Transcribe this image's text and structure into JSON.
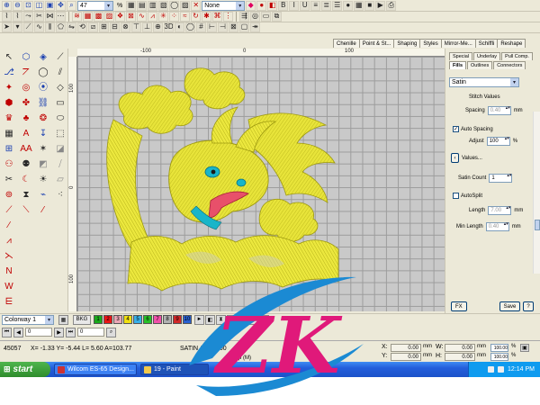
{
  "toolbar": {
    "zoom_value": "47",
    "zoom_unit": "%",
    "stitch_mode": "None",
    "design_zoom_value": "1",
    "design_zoom_unit": "%"
  },
  "object_tabs": [
    "Chenille",
    "Point & St...",
    "Shaping",
    "Styles",
    "Mirror-Me...",
    "Schiffli",
    "Reshape"
  ],
  "ruler": {
    "h_labels": [
      "-100",
      "0",
      "100"
    ],
    "v_labels": [
      "100",
      "0",
      "100"
    ]
  },
  "panel": {
    "tabs_row1": [
      "Special",
      "Underlay",
      "Pull Comp."
    ],
    "tabs_row2": [
      "Fills",
      "Outlines",
      "Connectors"
    ],
    "active_tab": "Fills",
    "fill_type": "Satin",
    "stitch_values_label": "Stitch Values",
    "spacing_label": "Spacing",
    "spacing_value": "0.40",
    "spacing_unit": "mm",
    "auto_spacing_label": "Auto Spacing",
    "auto_spacing_checked": true,
    "adjust_label": "Adjust",
    "adjust_value": "100",
    "adjust_unit": "%",
    "values_button": "Values...",
    "satin_count_label": "Satin Count",
    "satin_count_value": "1",
    "autosplit_label": "AutoSplit",
    "autosplit_checked": false,
    "length_label": "Length",
    "length_value": "7.00",
    "length_unit": "mm",
    "min_length_label": "Min Length",
    "min_length_value": "0.40",
    "min_length_unit": "mm",
    "fx_button": "FX",
    "save_button": "Save",
    "help_button": "?"
  },
  "colorway": {
    "label": "Colorway 1",
    "bkg_label": "BKG",
    "chips": [
      {
        "n": "1",
        "color": "#1aa81a"
      },
      {
        "n": "2",
        "color": "#e81414"
      },
      {
        "n": "3",
        "color": "#e8a6b4"
      },
      {
        "n": "4",
        "color": "#f0e010"
      },
      {
        "n": "5",
        "color": "#38b0e8"
      },
      {
        "n": "6",
        "color": "#28c028"
      },
      {
        "n": "7",
        "color": "#f050a8"
      },
      {
        "n": "8",
        "color": "#b0b0b0"
      },
      {
        "n": "9",
        "color": "#d02828"
      },
      {
        "n": "10",
        "color": "#2860d0"
      }
    ]
  },
  "minibar": {
    "field1": "0",
    "field2": "0"
  },
  "status": {
    "stitch_count": "45057",
    "coords": "X= -1.33 Y= -5.44 L= 5.60 A=103.77",
    "stitch_info": "SATIN Auto 1.00",
    "machine": "mp (M)",
    "x_label": "X:",
    "x_value": "0.00",
    "x_unit": "mm",
    "y_label": "Y:",
    "y_value": "0.00",
    "y_unit": "mm",
    "w_label": "W:",
    "w_value": "0.00",
    "w_unit": "mm",
    "h_label": "H:",
    "h_value": "0.00",
    "h_unit": "mm",
    "w_pct": "100.00",
    "h_pct": "100.00",
    "pct_unit": "%"
  },
  "taskbar": {
    "start_label": "start",
    "tasks": [
      "Wilcom ES-65 Design...",
      "19 - Paint"
    ],
    "clock": "12:14 PM"
  },
  "logo": {
    "text": "ZK",
    "colors": {
      "pink": "#e0197a",
      "blue": "#1b8ad3"
    }
  },
  "design_colors": {
    "gold": "#e8e43a",
    "gold_dark": "#b8b418",
    "tongue": "#e8506a",
    "teal": "#19b5c9"
  }
}
